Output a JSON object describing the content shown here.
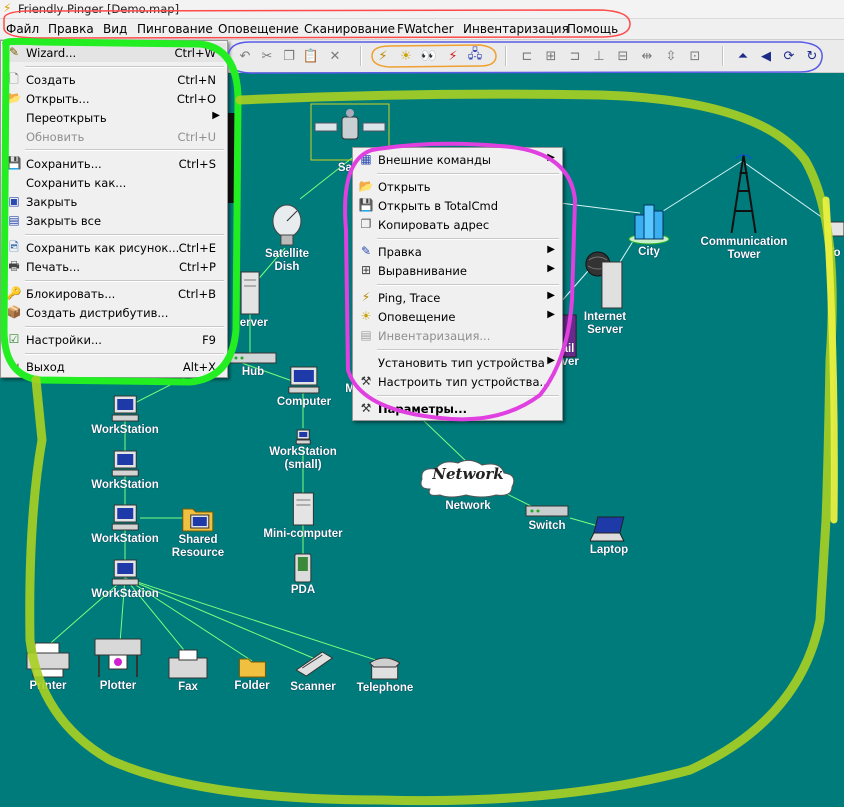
{
  "window": {
    "title": "Friendly Pinger [Demo.map]"
  },
  "menubar": [
    "Файл",
    "Правка",
    "Вид",
    "Пингование",
    "Оповещение",
    "Сканирование",
    "FWatcher",
    "Инвентаризация",
    "Помощь"
  ],
  "file_menu": {
    "items": [
      {
        "label": "Wizard...",
        "shortcut": "Ctrl+W",
        "icon": "wizard-icon"
      },
      {
        "label": "Создать",
        "shortcut": "Ctrl+N",
        "icon": "new-document-icon"
      },
      {
        "label": "Открыть...",
        "shortcut": "Ctrl+O",
        "icon": "open-folder-icon"
      },
      {
        "label": "Переоткрыть",
        "shortcut": "",
        "icon": "",
        "submenu": true
      },
      {
        "label": "Обновить",
        "shortcut": "Ctrl+U",
        "icon": "",
        "disabled": true
      },
      {
        "label": "Сохранить...",
        "shortcut": "Ctrl+S",
        "icon": "save-icon"
      },
      {
        "label": "Сохранить как...",
        "shortcut": "",
        "icon": ""
      },
      {
        "label": "Закрыть",
        "shortcut": "",
        "icon": "close-map-icon"
      },
      {
        "label": "Закрыть все",
        "shortcut": "",
        "icon": "close-all-icon"
      },
      {
        "label": "Сохранить как рисунок...",
        "shortcut": "Ctrl+E",
        "icon": "save-image-icon"
      },
      {
        "label": "Печать...",
        "shortcut": "Ctrl+P",
        "icon": "printer-icon"
      },
      {
        "label": "Блокировать...",
        "shortcut": "Ctrl+B",
        "icon": "lock-key-icon"
      },
      {
        "label": "Создать дистрибутив...",
        "shortcut": "",
        "icon": "package-icon"
      },
      {
        "label": "Настройки...",
        "shortcut": "F9",
        "icon": "settings-check-icon"
      },
      {
        "label": "Выход",
        "shortcut": "Alt+X",
        "icon": "exit-icon"
      }
    ]
  },
  "context_menu": {
    "items": [
      {
        "label": "Внешние команды",
        "icon": "external-commands-icon",
        "submenu": true
      },
      {
        "label": "Открыть",
        "icon": "open-folder-icon"
      },
      {
        "label": "Открыть в TotalCmd",
        "icon": "totalcmd-icon"
      },
      {
        "label": "Копировать адрес",
        "icon": "copy-icon"
      },
      {
        "label": "Правка",
        "icon": "edit-icon",
        "submenu": true
      },
      {
        "label": "Выравнивание",
        "icon": "align-icon",
        "submenu": true
      },
      {
        "label": "Ping, Trace",
        "icon": "lightning-icon",
        "submenu": true
      },
      {
        "label": "Оповещение",
        "icon": "alert-bulb-icon",
        "submenu": true
      },
      {
        "label": "Инвентаризация...",
        "icon": "inventory-icon",
        "disabled": true
      },
      {
        "label": "Установить тип устройства",
        "icon": "device-type-icon",
        "submenu": true
      },
      {
        "label": "Настроить тип устройства...",
        "icon": "tools-icon"
      },
      {
        "label": "Параметры...",
        "icon": "parameters-icon",
        "bold": true
      }
    ]
  },
  "map": {
    "nodes": {
      "satellite": "Sate",
      "satellite_dish": "Satellite\nDish",
      "server": "Server",
      "hub": "Hub",
      "computer": "Computer",
      "modem": "M",
      "city": "City",
      "comm_tower": "Communication\nTower",
      "tower_partial": "To",
      "internet_server": "Internet\nServer",
      "mail_server": "ail\nrver",
      "workstation_1": "WorkStation",
      "workstation_2": "WorkStation",
      "workstation_3": "WorkStation",
      "workstation_4": "WorkStation",
      "shared_resource": "Shared\nResource",
      "workstation_small": "WorkStation\n(small)",
      "mini_computer": "Mini-computer",
      "pda": "PDA",
      "network_cloud": "Network",
      "network": "Network",
      "switch": "Switch",
      "laptop": "Laptop",
      "printer": "Printer",
      "plotter": "Plotter",
      "fax": "Fax",
      "folder": "Folder",
      "scanner": "Scanner",
      "telephone": "Telephone"
    }
  },
  "colors": {
    "map_background": "#007b7b",
    "link_green": "#7cff7c",
    "link_white": "#d8f4f4",
    "annotation_red": "#ff4a4a",
    "annotation_blue": "#5a5ae8",
    "annotation_orange": "#f0a030",
    "annotation_green": "#22ee22",
    "annotation_magenta": "#e040e0",
    "annotation_yellowgreen": "#a8d020"
  }
}
